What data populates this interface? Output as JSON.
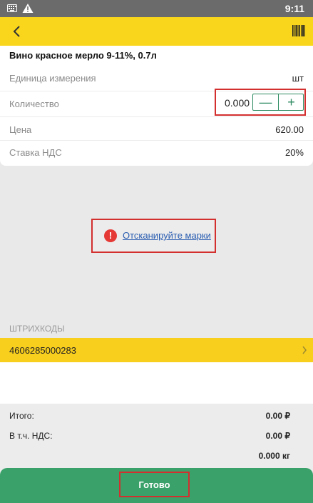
{
  "status_bar": {
    "time": "9:11",
    "icons": [
      "keyboard-icon",
      "warning-icon"
    ]
  },
  "app_bar": {
    "back_icon": "arrow-left-icon",
    "barcode_icon": "barcode-icon"
  },
  "product": {
    "title": "Вино красное мерло 9-11%, 0.7л",
    "unit_label": "Единица измерения",
    "unit_value": "шт",
    "quantity_label": "Количество",
    "quantity_value": "0.000",
    "minus_label": "—",
    "plus_label": "+",
    "price_label": "Цена",
    "price_value": "620.00",
    "vat_label": "Ставка НДС",
    "vat_value": "20%"
  },
  "scan": {
    "link_text": "Отсканируйте марки",
    "error_icon": "!"
  },
  "barcodes": {
    "header": "ШТРИХКОДЫ",
    "items": [
      "4606285000283"
    ]
  },
  "totals": {
    "total_label": "Итого:",
    "total_value": "0.00 ₽",
    "vat_label": "В т.ч. НДС:",
    "vat_value": "0.00 ₽",
    "weight_value": "0.000 кг"
  },
  "done_button": {
    "label": "Готово"
  },
  "colors": {
    "accent_yellow": "#f9d61c",
    "green": "#3aa16a",
    "highlight_red": "#d32f2f",
    "link_blue": "#2a5db0"
  }
}
